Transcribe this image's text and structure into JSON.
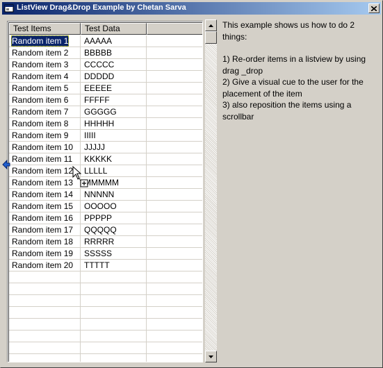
{
  "window": {
    "title": "ListView Drag&Drop Example by Chetan Sarva",
    "app_icon": "vb-form-icon",
    "close_icon": "close-icon"
  },
  "listview": {
    "columns": [
      "Test Items",
      "Test Data"
    ],
    "selected_index": 0,
    "rows": [
      [
        "Random item 1",
        "AAAAA"
      ],
      [
        "Random item 2",
        "BBBBB"
      ],
      [
        "Random item 3",
        "CCCCC"
      ],
      [
        "Random item 4",
        "DDDDD"
      ],
      [
        "Random item 5",
        "EEEEE"
      ],
      [
        "Random item 6",
        "FFFFF"
      ],
      [
        "Random item 7",
        "GGGGG"
      ],
      [
        "Random item 8",
        "HHHHH"
      ],
      [
        "Random item 9",
        "IIIII"
      ],
      [
        "Random item 10",
        "JJJJJ"
      ],
      [
        "Random item 11",
        "KKKKK"
      ],
      [
        "Random item 12",
        "LLLLL"
      ],
      [
        "Random item 13",
        "MMMMM"
      ],
      [
        "Random item 14",
        "NNNNN"
      ],
      [
        "Random item 15",
        "OOOOO"
      ],
      [
        "Random item 16",
        "PPPPP"
      ],
      [
        "Random item 17",
        "QQQQQ"
      ],
      [
        "Random item 18",
        "RRRRR"
      ],
      [
        "Random item 19",
        "SSSSS"
      ],
      [
        "Random item 20",
        "TTTTT"
      ]
    ]
  },
  "description": {
    "intro": "This example shows us how to do 2 things:",
    "items": [
      "1) Re-order items in a listview by using drag _drop",
      "2) Give a visual cue to the user for the placement of the item",
      "3) also reposition the items using a scrollbar"
    ]
  },
  "colors": {
    "title_gradient_start": "#0a246a",
    "title_gradient_end": "#a6caf0",
    "selection": "#0a246a",
    "drop_marker": "#2060d0"
  }
}
